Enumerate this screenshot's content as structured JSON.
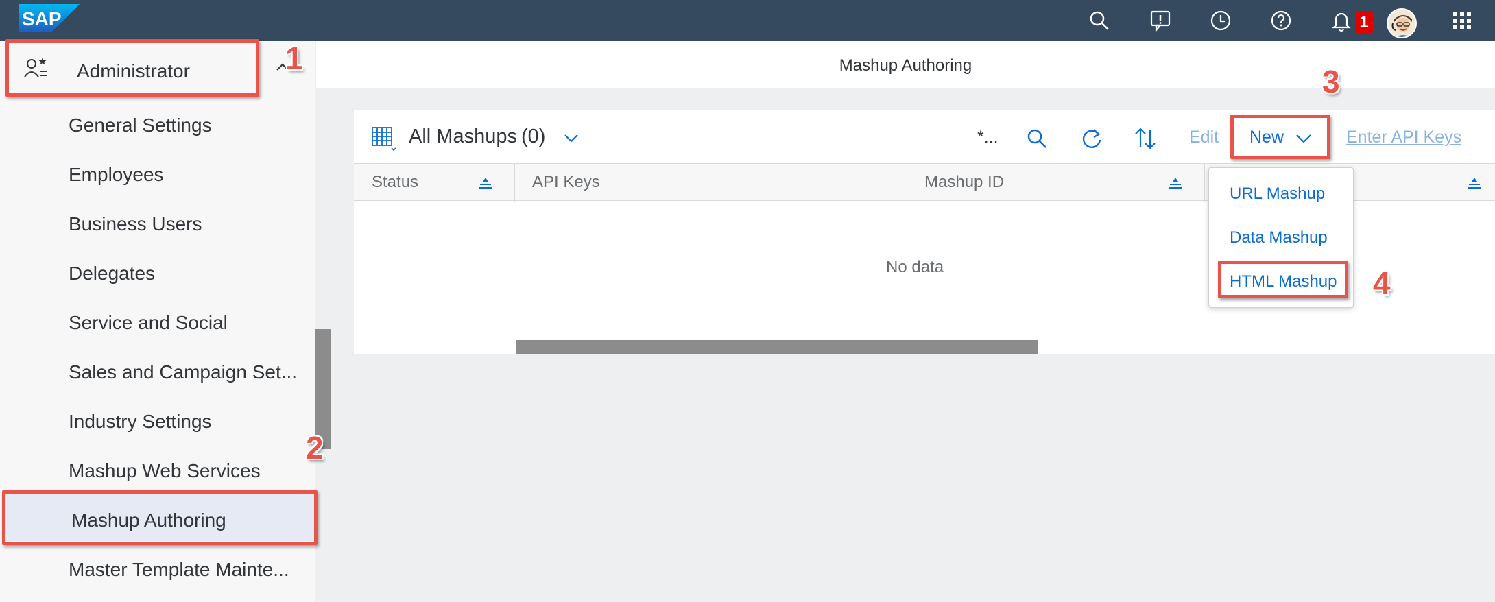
{
  "shell": {
    "logo_text": "SAP",
    "notification_count": "1",
    "icons": [
      "search-icon",
      "feedback-icon",
      "recent-activity-icon",
      "help-icon",
      "bell-icon",
      "avatar",
      "app-launcher-icon"
    ]
  },
  "sidebar": {
    "header_label": "Administrator",
    "items": [
      {
        "label": "General Settings"
      },
      {
        "label": "Employees"
      },
      {
        "label": "Business Users"
      },
      {
        "label": "Delegates"
      },
      {
        "label": "Service and Social"
      },
      {
        "label": "Sales and Campaign Set..."
      },
      {
        "label": "Industry Settings"
      },
      {
        "label": "Mashup Web Services"
      },
      {
        "label": "Mashup Authoring"
      },
      {
        "label": "Master Template Mainte..."
      }
    ],
    "selected": "Mashup Authoring"
  },
  "page": {
    "title": "Mashup Authoring"
  },
  "toolbar": {
    "view_title": "All Mashups",
    "count": "(0)",
    "filter_text": "*...",
    "edit_label": "Edit",
    "new_label": "New",
    "api_keys_label": "Enter API Keys"
  },
  "table": {
    "columns": [
      "Status",
      "API Keys",
      "Mashup ID"
    ],
    "empty_text": "No data"
  },
  "new_menu": {
    "items": [
      "URL Mashup",
      "Data Mashup",
      "HTML Mashup"
    ]
  },
  "callouts": [
    "1",
    "2",
    "3",
    "4"
  ],
  "colors": {
    "shell": "#354a5f",
    "accent": "#0a6ed1",
    "highlight": "#e8534a",
    "selected_bg": "#e5eaf5"
  }
}
